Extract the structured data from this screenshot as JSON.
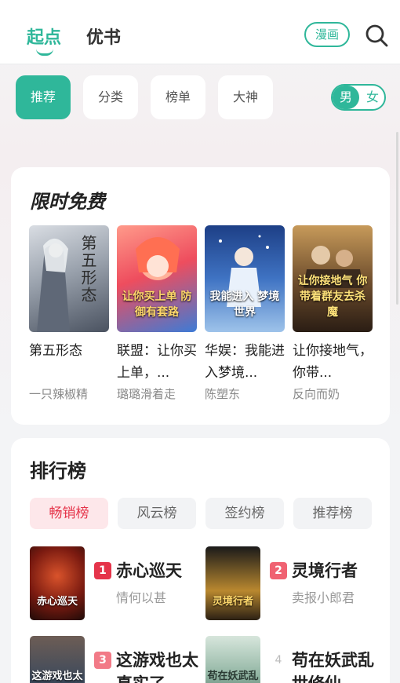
{
  "topnav": {
    "tabs": [
      {
        "label": "起点"
      },
      {
        "label": "优书"
      }
    ],
    "manga_label": "漫画",
    "search_icon": "search-icon"
  },
  "filters": {
    "chips": [
      {
        "label": "推荐"
      },
      {
        "label": "分类"
      },
      {
        "label": "榜单"
      },
      {
        "label": "大神"
      }
    ],
    "gender": {
      "selected": "男",
      "other": "女"
    }
  },
  "free_section": {
    "title": "限时免费",
    "books": [
      {
        "title": "第五形态",
        "author": "一只辣椒精",
        "cover_text": "第五形态"
      },
      {
        "title": "联盟：让你买上单，...",
        "author": "璐璐滑着走",
        "cover_text": "让你买上单 防御有套路"
      },
      {
        "title": "华娱：我能进入梦境...",
        "author": "陈塑东",
        "cover_text": "我能进入 梦境世界"
      },
      {
        "title": "让你接地气，你带...",
        "author": "反向而奶",
        "cover_text": "让你接地气 你带着群友去杀魔"
      }
    ]
  },
  "rank_section": {
    "title": "排行榜",
    "tabs": [
      {
        "label": "畅销榜"
      },
      {
        "label": "风云榜"
      },
      {
        "label": "签约榜"
      },
      {
        "label": "推荐榜"
      }
    ],
    "items": [
      {
        "rank": "1",
        "name": "赤心巡天",
        "author": "情何以甚",
        "cover_text": "赤心巡天"
      },
      {
        "rank": "2",
        "name": "灵境行者",
        "author": "卖报小郎君",
        "cover_text": "灵境行者"
      },
      {
        "rank": "3",
        "name": "这游戏也太真实了",
        "author": "",
        "cover_text": "这游戏也太真实了"
      },
      {
        "rank": "4",
        "name": "苟在妖武乱世修仙",
        "author": "",
        "cover_text": "苟在妖武乱世修仙"
      }
    ]
  },
  "colors": {
    "accent": "#2fb79a",
    "rank_red": "#e5344a",
    "rank_2": "#f06272",
    "rank_3": "#f27a87"
  }
}
